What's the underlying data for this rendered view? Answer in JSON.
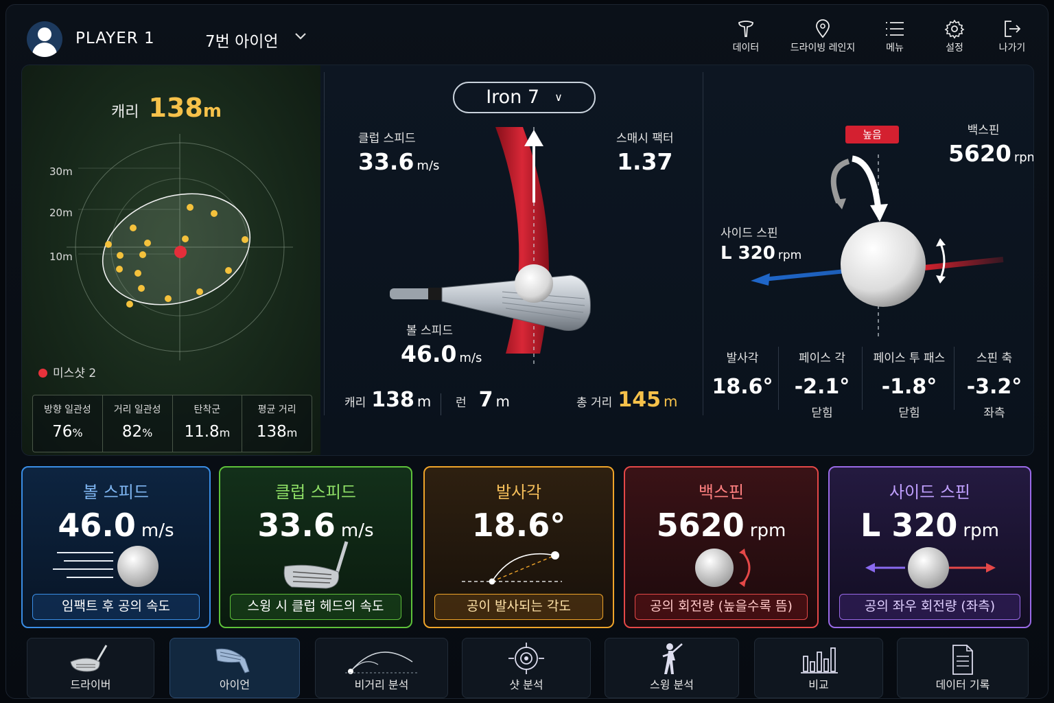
{
  "header": {
    "player": "PLAYER 1",
    "club": "7번 아이언",
    "nav": [
      {
        "label": "데이터",
        "icon": "tee-icon"
      },
      {
        "label": "드라이빙 레인지",
        "icon": "location-pin-icon"
      },
      {
        "label": "메뉴",
        "icon": "menu-list-icon"
      },
      {
        "label": "설정",
        "icon": "gear-icon"
      },
      {
        "label": "나가기",
        "icon": "exit-icon"
      }
    ]
  },
  "dispersion": {
    "carry_label": "캐리",
    "carry_value": "138",
    "carry_unit": "m",
    "rings": [
      "30m",
      "20m",
      "10m"
    ],
    "miss_label": "미스샷 2",
    "stats": [
      {
        "label": "방향 일관성",
        "value": "76",
        "unit": "%"
      },
      {
        "label": "거리 일관성",
        "value": "82",
        "unit": "%"
      },
      {
        "label": "탄착군",
        "value": "11.8",
        "unit": "m"
      },
      {
        "label": "평균 거리",
        "value": "138",
        "unit": "m"
      }
    ]
  },
  "center": {
    "club_pill": "Iron 7",
    "club_speed_label": "클럽 스피드",
    "club_speed_value": "33.6",
    "club_speed_unit": "m/s",
    "smash_label": "스매시 팩터",
    "smash_value": "1.37",
    "ball_speed_label": "볼 스피드",
    "ball_speed_value": "46.0",
    "ball_speed_unit": "m/s",
    "carry_label": "캐리",
    "carry_value": "138",
    "carry_unit": "m",
    "run_label": "런",
    "run_value": "7",
    "run_unit": "m",
    "total_label": "총 거리",
    "total_value": "145",
    "total_unit": "m"
  },
  "right": {
    "high_badge": "높음",
    "backspin_label": "백스핀",
    "backspin_value": "5620",
    "backspin_unit": "rpm",
    "sidespin_label": "사이드 스핀",
    "sidespin_value": "L 320",
    "sidespin_unit": "rpm",
    "metrics": [
      {
        "label": "발사각",
        "value": "18.6°",
        "note": ""
      },
      {
        "label": "페이스 각",
        "value": "-2.1°",
        "note": "닫힘"
      },
      {
        "label": "페이스 투 패스",
        "value": "-1.8°",
        "note": "닫힘"
      },
      {
        "label": "스핀 축",
        "value": "-3.2°",
        "note": "좌측"
      }
    ]
  },
  "cards": [
    {
      "title": "볼 스피드",
      "value": "46.0",
      "unit": "m/s",
      "desc": "임팩트 후 공의 속도",
      "color": "#3a8ee6"
    },
    {
      "title": "클럽 스피드",
      "value": "33.6",
      "unit": "m/s",
      "desc": "스윙 시 클럽 헤드의 속도",
      "color": "#5ec23a"
    },
    {
      "title": "발사각",
      "value": "18.6°",
      "unit": "",
      "desc": "공이 발사되는 각도",
      "color": "#f0a52a"
    },
    {
      "title": "백스핀",
      "value": "5620",
      "unit": "rpm",
      "desc": "공의 회전량 (높을수록 뜸)",
      "color": "#e54848"
    },
    {
      "title": "사이드 스핀",
      "value": "L 320",
      "unit": "rpm",
      "desc": "공의 좌우 회전량 (좌측)",
      "color": "#9a6ae8"
    }
  ],
  "bottom_nav": [
    {
      "label": "드라이버",
      "icon": "driver-icon"
    },
    {
      "label": "아이언",
      "icon": "iron-icon"
    },
    {
      "label": "비거리 분석",
      "icon": "trajectory-icon"
    },
    {
      "label": "샷 분석",
      "icon": "target-icon"
    },
    {
      "label": "스윙 분석",
      "icon": "golfer-icon"
    },
    {
      "label": "비교",
      "icon": "bar-compare-icon"
    },
    {
      "label": "데이터 기록",
      "icon": "document-icon"
    }
  ]
}
